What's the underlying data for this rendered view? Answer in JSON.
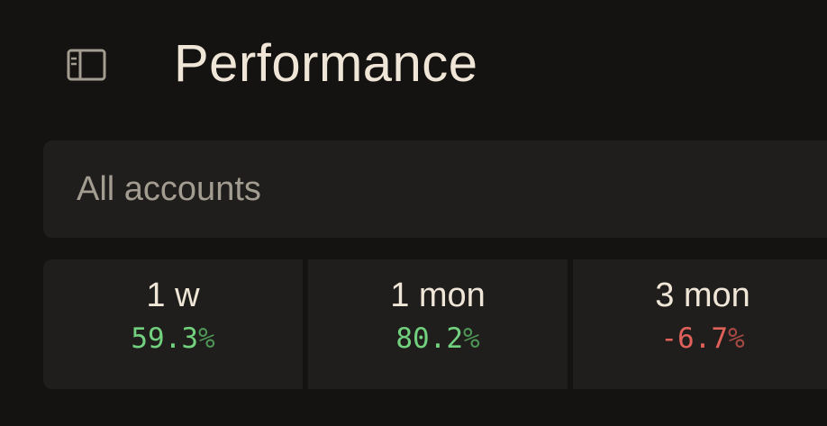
{
  "header": {
    "sidebar_icon": "sidebar-toggle-icon",
    "title": "Performance"
  },
  "account_filter": {
    "selected": "All accounts"
  },
  "periods": [
    {
      "label": "1 w",
      "change": "59.3",
      "unit": "%",
      "trend": "up"
    },
    {
      "label": "1 mon",
      "change": "80.2",
      "unit": "%",
      "trend": "up"
    },
    {
      "label": "3 mon",
      "change": "-6.7",
      "unit": "%",
      "trend": "down"
    }
  ],
  "colors": {
    "background": "#141312",
    "card": "#1f1e1c",
    "positive": "#72d17e",
    "negative": "#e0605a",
    "text": "#efe6d8",
    "muted": "#a39c90"
  }
}
